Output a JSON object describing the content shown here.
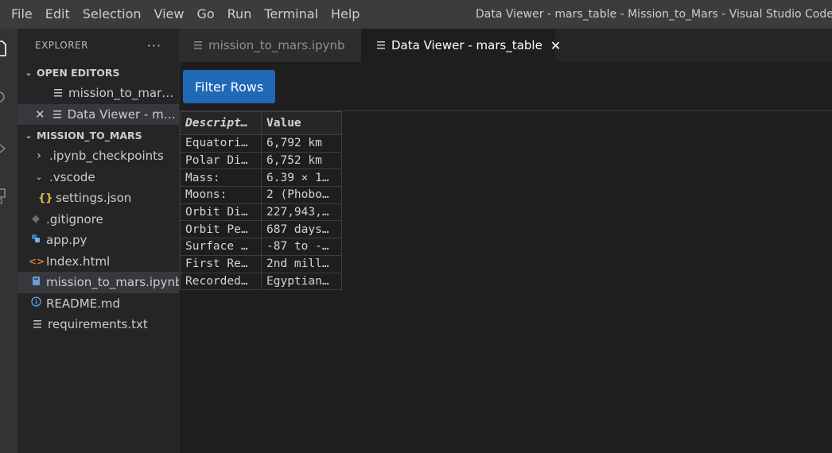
{
  "menu": [
    "File",
    "Edit",
    "Selection",
    "View",
    "Go",
    "Run",
    "Terminal",
    "Help"
  ],
  "window_title": "Data Viewer - mars_table - Mission_to_Mars - Visual Studio Code",
  "explorer": {
    "title": "EXPLORER",
    "more": "···",
    "open_editors": {
      "header": "OPEN EDITORS",
      "items": [
        {
          "label": "mission_to_mars.i..."
        },
        {
          "label": "Data Viewer - mar..."
        }
      ]
    },
    "project": {
      "header": "MISSION_TO_MARS",
      "items": [
        {
          "label": ".ipynb_checkpoints",
          "icon": "chevron-right-icon"
        },
        {
          "label": ".vscode",
          "icon": "chevron-down-icon"
        },
        {
          "label": "settings.json",
          "icon": "json-braces-icon"
        },
        {
          "label": ".gitignore",
          "icon": "git-icon"
        },
        {
          "label": "app.py",
          "icon": "python-icon"
        },
        {
          "label": "Index.html",
          "icon": "html-icon"
        },
        {
          "label": "mission_to_mars.ipynb",
          "icon": "notebook-icon"
        },
        {
          "label": "README.md",
          "icon": "info-icon"
        },
        {
          "label": "requirements.txt",
          "icon": "lines-icon"
        }
      ]
    }
  },
  "tabs": [
    {
      "label": "mission_to_mars.ipynb",
      "active": false
    },
    {
      "label": "Data Viewer - mars_table",
      "active": true,
      "close": "✕"
    }
  ],
  "toolbar": {
    "filter_label": "Filter Rows"
  },
  "table": {
    "headers": [
      "Descript…",
      "Value"
    ],
    "rows": [
      [
        "Equatori…",
        "6,792 km"
      ],
      [
        "Polar Di…",
        "6,752 km"
      ],
      [
        "Mass:",
        "6.39 × 1…"
      ],
      [
        "Moons:",
        "2 (Phobo…"
      ],
      [
        "Orbit Di…",
        "227,943,…"
      ],
      [
        "Orbit Pe…",
        "687 days…"
      ],
      [
        "Surface …",
        "-87 to -…"
      ],
      [
        "First Re…",
        "2nd mill…"
      ],
      [
        "Recorded…",
        "Egyptian…"
      ]
    ]
  },
  "colors": {
    "accent_button": "#1f69b5",
    "title_bar": "#3c3c3c",
    "sidebar": "#252526",
    "editor": "#1e1e1e"
  }
}
